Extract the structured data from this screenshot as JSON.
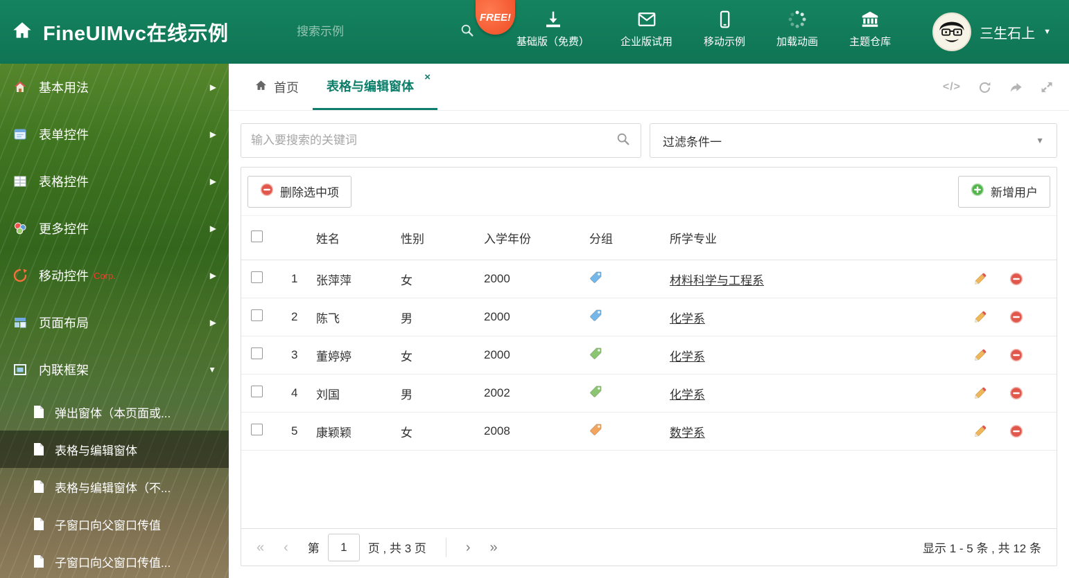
{
  "colors": {
    "accent": "#0f7d6b",
    "header_bg": "#14825e",
    "danger": "#e2574c",
    "success": "#52b54b"
  },
  "header": {
    "title": "FineUIMvc在线示例",
    "search_placeholder": "搜索示例",
    "free_badge": "FREE!",
    "nav_items": [
      {
        "label": "基础版（免费）",
        "icon": "download-icon"
      },
      {
        "label": "企业版试用",
        "icon": "mail-icon"
      },
      {
        "label": "移动示例",
        "icon": "mobile-icon"
      },
      {
        "label": "加载动画",
        "icon": "spinner-icon"
      },
      {
        "label": "主题仓库",
        "icon": "bank-icon"
      }
    ],
    "user_name": "三生石上"
  },
  "sidebar": {
    "items": [
      {
        "label": "基本用法"
      },
      {
        "label": "表单控件"
      },
      {
        "label": "表格控件"
      },
      {
        "label": "更多控件"
      },
      {
        "label": "移动控件",
        "badge": "Corp."
      },
      {
        "label": "页面布局"
      },
      {
        "label": "内联框架"
      }
    ],
    "subitems": [
      {
        "label": "弹出窗体（本页面或..."
      },
      {
        "label": "表格与编辑窗体"
      },
      {
        "label": "表格与编辑窗体（不..."
      },
      {
        "label": "子窗口向父窗口传值"
      },
      {
        "label": "子窗口向父窗口传值..."
      }
    ]
  },
  "tabs": {
    "items": [
      {
        "label": "首页"
      },
      {
        "label": "表格与编辑窗体",
        "active": true
      }
    ]
  },
  "filter": {
    "search_placeholder": "输入要搜索的关键词",
    "dropdown_value": "过滤条件一"
  },
  "toolbar": {
    "delete_label": "删除选中项",
    "add_label": "新增用户"
  },
  "table": {
    "columns": [
      "姓名",
      "性别",
      "入学年份",
      "分组",
      "所学专业"
    ],
    "rows": [
      {
        "index": "1",
        "name": "张萍萍",
        "gender": "女",
        "year": "2000",
        "tag_color": "#74b7e8",
        "major": "材料科学与工程系"
      },
      {
        "index": "2",
        "name": "陈飞",
        "gender": "男",
        "year": "2000",
        "tag_color": "#74b7e8",
        "major": "化学系"
      },
      {
        "index": "3",
        "name": "董婷婷",
        "gender": "女",
        "year": "2000",
        "tag_color": "#8cc572",
        "major": "化学系"
      },
      {
        "index": "4",
        "name": "刘国",
        "gender": "男",
        "year": "2002",
        "tag_color": "#8cc572",
        "major": "化学系"
      },
      {
        "index": "5",
        "name": "康颖颖",
        "gender": "女",
        "year": "2008",
        "tag_color": "#f2a55e",
        "major": "数学系"
      }
    ]
  },
  "pagination": {
    "first": "«",
    "prev": "‹",
    "next": "›",
    "last": "»",
    "label_page": "第",
    "current": "1",
    "label_total": "页 , 共 3 页",
    "summary": "显示 1 - 5 条 , 共 12 条"
  }
}
